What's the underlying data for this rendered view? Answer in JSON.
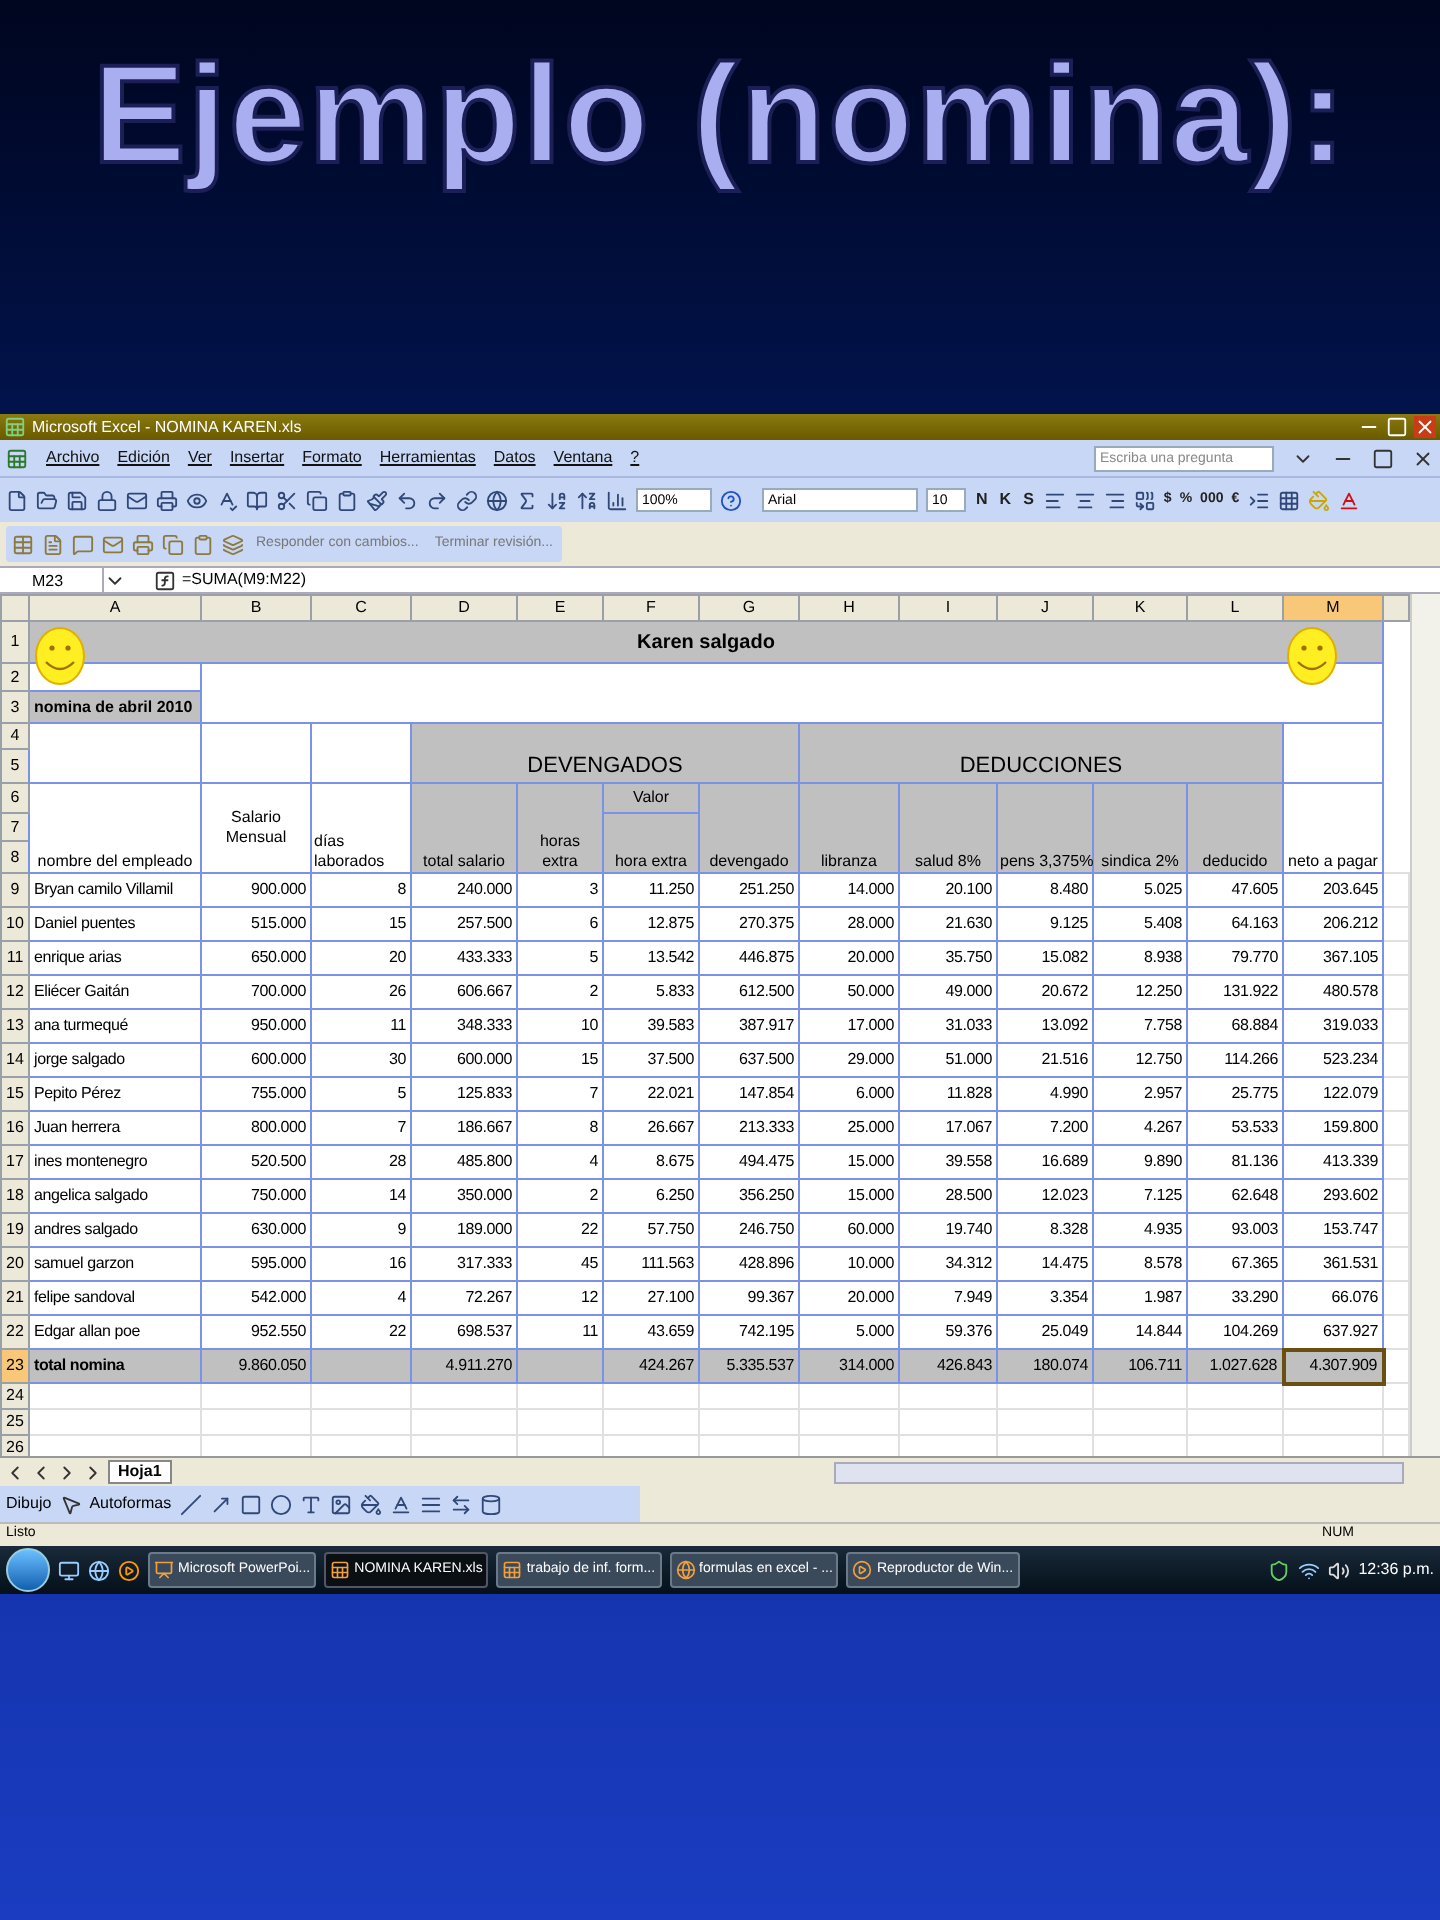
{
  "slide": {
    "title": "Ejemplo (nomina):"
  },
  "window": {
    "title": "Microsoft Excel - NOMINA KAREN.xls"
  },
  "menu": {
    "items": [
      "Archivo",
      "Edición",
      "Ver",
      "Insertar",
      "Formato",
      "Herramientas",
      "Datos",
      "Ventana",
      "?"
    ],
    "search_placeholder": "Escriba una pregunta"
  },
  "toolbar": {
    "zoom": "100%",
    "font": "Arial",
    "font_size": "10",
    "style_buttons": [
      "N",
      "K",
      "S"
    ],
    "number_buttons": [
      "$",
      "%",
      "000",
      "€"
    ]
  },
  "review_toolbar": {
    "items": [
      "Responder con cambios...",
      "Terminar revisión..."
    ]
  },
  "formula_bar": {
    "name_box": "M23",
    "formula": "=SUMA(M9:M22)"
  },
  "columns": [
    {
      "label": "A",
      "selected": false
    },
    {
      "label": "B",
      "selected": false
    },
    {
      "label": "C",
      "selected": false
    },
    {
      "label": "D",
      "selected": false
    },
    {
      "label": "E",
      "selected": false
    },
    {
      "label": "F",
      "selected": false
    },
    {
      "label": "G",
      "selected": false
    },
    {
      "label": "H",
      "selected": false
    },
    {
      "label": "I",
      "selected": false
    },
    {
      "label": "J",
      "selected": false
    },
    {
      "label": "K",
      "selected": false
    },
    {
      "label": "L",
      "selected": false
    },
    {
      "label": "M",
      "selected": true
    }
  ],
  "header_row_numbers": [
    "1",
    "2",
    "3",
    "4",
    "5",
    "6",
    "7",
    "8"
  ],
  "sheet": {
    "title": "Karen salgado",
    "subtitle": "nomina de abril 2010",
    "group_earned": "DEVENGADOS",
    "group_deductions": "DEDUCCIONES",
    "value_label": "Valor",
    "headers": [
      "nombre del empleado",
      "Salario Mensual",
      "días laborados",
      "total salario",
      "horas extra",
      "hora extra",
      "devengado",
      "libranza",
      "salud 8%",
      "pens 3,375%",
      "sindica 2%",
      "deducido",
      "neto a pagar"
    ]
  },
  "rows": [
    {
      "number": "9",
      "selected": false,
      "cells": [
        "Bryan camilo Villamil",
        "900.000",
        "8",
        "240.000",
        "3",
        "11.250",
        "251.250",
        "14.000",
        "20.100",
        "8.480",
        "5.025",
        "47.605",
        "203.645"
      ]
    },
    {
      "number": "10",
      "selected": false,
      "cells": [
        "Daniel puentes",
        "515.000",
        "15",
        "257.500",
        "6",
        "12.875",
        "270.375",
        "28.000",
        "21.630",
        "9.125",
        "5.408",
        "64.163",
        "206.212"
      ]
    },
    {
      "number": "11",
      "selected": false,
      "cells": [
        "enrique arias",
        "650.000",
        "20",
        "433.333",
        "5",
        "13.542",
        "446.875",
        "20.000",
        "35.750",
        "15.082",
        "8.938",
        "79.770",
        "367.105"
      ]
    },
    {
      "number": "12",
      "selected": false,
      "cells": [
        "Eliécer Gaitán",
        "700.000",
        "26",
        "606.667",
        "2",
        "5.833",
        "612.500",
        "50.000",
        "49.000",
        "20.672",
        "12.250",
        "131.922",
        "480.578"
      ]
    },
    {
      "number": "13",
      "selected": false,
      "cells": [
        "ana turmequé",
        "950.000",
        "11",
        "348.333",
        "10",
        "39.583",
        "387.917",
        "17.000",
        "31.033",
        "13.092",
        "7.758",
        "68.884",
        "319.033"
      ]
    },
    {
      "number": "14",
      "selected": false,
      "cells": [
        "jorge salgado",
        "600.000",
        "30",
        "600.000",
        "15",
        "37.500",
        "637.500",
        "29.000",
        "51.000",
        "21.516",
        "12.750",
        "114.266",
        "523.234"
      ]
    },
    {
      "number": "15",
      "selected": false,
      "cells": [
        "Pepito Pérez",
        "755.000",
        "5",
        "125.833",
        "7",
        "22.021",
        "147.854",
        "6.000",
        "11.828",
        "4.990",
        "2.957",
        "25.775",
        "122.079"
      ]
    },
    {
      "number": "16",
      "selected": false,
      "cells": [
        "Juan herrera",
        "800.000",
        "7",
        "186.667",
        "8",
        "26.667",
        "213.333",
        "25.000",
        "17.067",
        "7.200",
        "4.267",
        "53.533",
        "159.800"
      ]
    },
    {
      "number": "17",
      "selected": false,
      "cells": [
        "ines montenegro",
        "520.500",
        "28",
        "485.800",
        "4",
        "8.675",
        "494.475",
        "15.000",
        "39.558",
        "16.689",
        "9.890",
        "81.136",
        "413.339"
      ]
    },
    {
      "number": "18",
      "selected": false,
      "cells": [
        "angelica salgado",
        "750.000",
        "14",
        "350.000",
        "2",
        "6.250",
        "356.250",
        "15.000",
        "28.500",
        "12.023",
        "7.125",
        "62.648",
        "293.602"
      ]
    },
    {
      "number": "19",
      "selected": false,
      "cells": [
        "andres salgado",
        "630.000",
        "9",
        "189.000",
        "22",
        "57.750",
        "246.750",
        "60.000",
        "19.740",
        "8.328",
        "4.935",
        "93.003",
        "153.747"
      ]
    },
    {
      "number": "20",
      "selected": false,
      "cells": [
        "samuel garzon",
        "595.000",
        "16",
        "317.333",
        "45",
        "111.563",
        "428.896",
        "10.000",
        "34.312",
        "14.475",
        "8.578",
        "67.365",
        "361.531"
      ]
    },
    {
      "number": "21",
      "selected": false,
      "cells": [
        "felipe sandoval",
        "542.000",
        "4",
        "72.267",
        "12",
        "27.100",
        "99.367",
        "20.000",
        "7.949",
        "3.354",
        "1.987",
        "33.290",
        "66.076"
      ]
    },
    {
      "number": "22",
      "selected": false,
      "cells": [
        "Edgar allan poe",
        "952.550",
        "22",
        "698.537",
        "11",
        "43.659",
        "742.195",
        "5.000",
        "59.376",
        "25.049",
        "14.844",
        "104.269",
        "637.927"
      ]
    },
    {
      "number": "23",
      "selected": true,
      "kind": "total",
      "cells": [
        "total nomina",
        "9.860.050",
        null,
        "4.911.270",
        null,
        "424.267",
        "5.335.537",
        "314.000",
        "426.843",
        "180.074",
        "106.711",
        "1.027.628",
        "4.307.909"
      ]
    }
  ],
  "footer_row_numbers": [
    "24",
    "25",
    "26"
  ],
  "sheet_tabs": [
    {
      "label": "Hoja1",
      "selected": true
    }
  ],
  "drawing_toolbar": {
    "items": [
      "Dibujo",
      "Autoformas"
    ]
  },
  "status_bar": {
    "status": "Listo",
    "indicator": "NUM"
  },
  "taskbar": {
    "items": [
      {
        "label": "Microsoft PowerPoi...",
        "kind": "slides",
        "selected": false
      },
      {
        "label": "NOMINA KAREN.xls",
        "kind": "sheet",
        "selected": true
      },
      {
        "label": "trabajo de inf. form...",
        "kind": "sheet",
        "selected": false
      },
      {
        "label": "formulas en excel - ...",
        "kind": "browser",
        "selected": false
      },
      {
        "label": "Reproductor de Win...",
        "kind": "player",
        "selected": false
      }
    ],
    "clock": "12:36 p.m."
  }
}
